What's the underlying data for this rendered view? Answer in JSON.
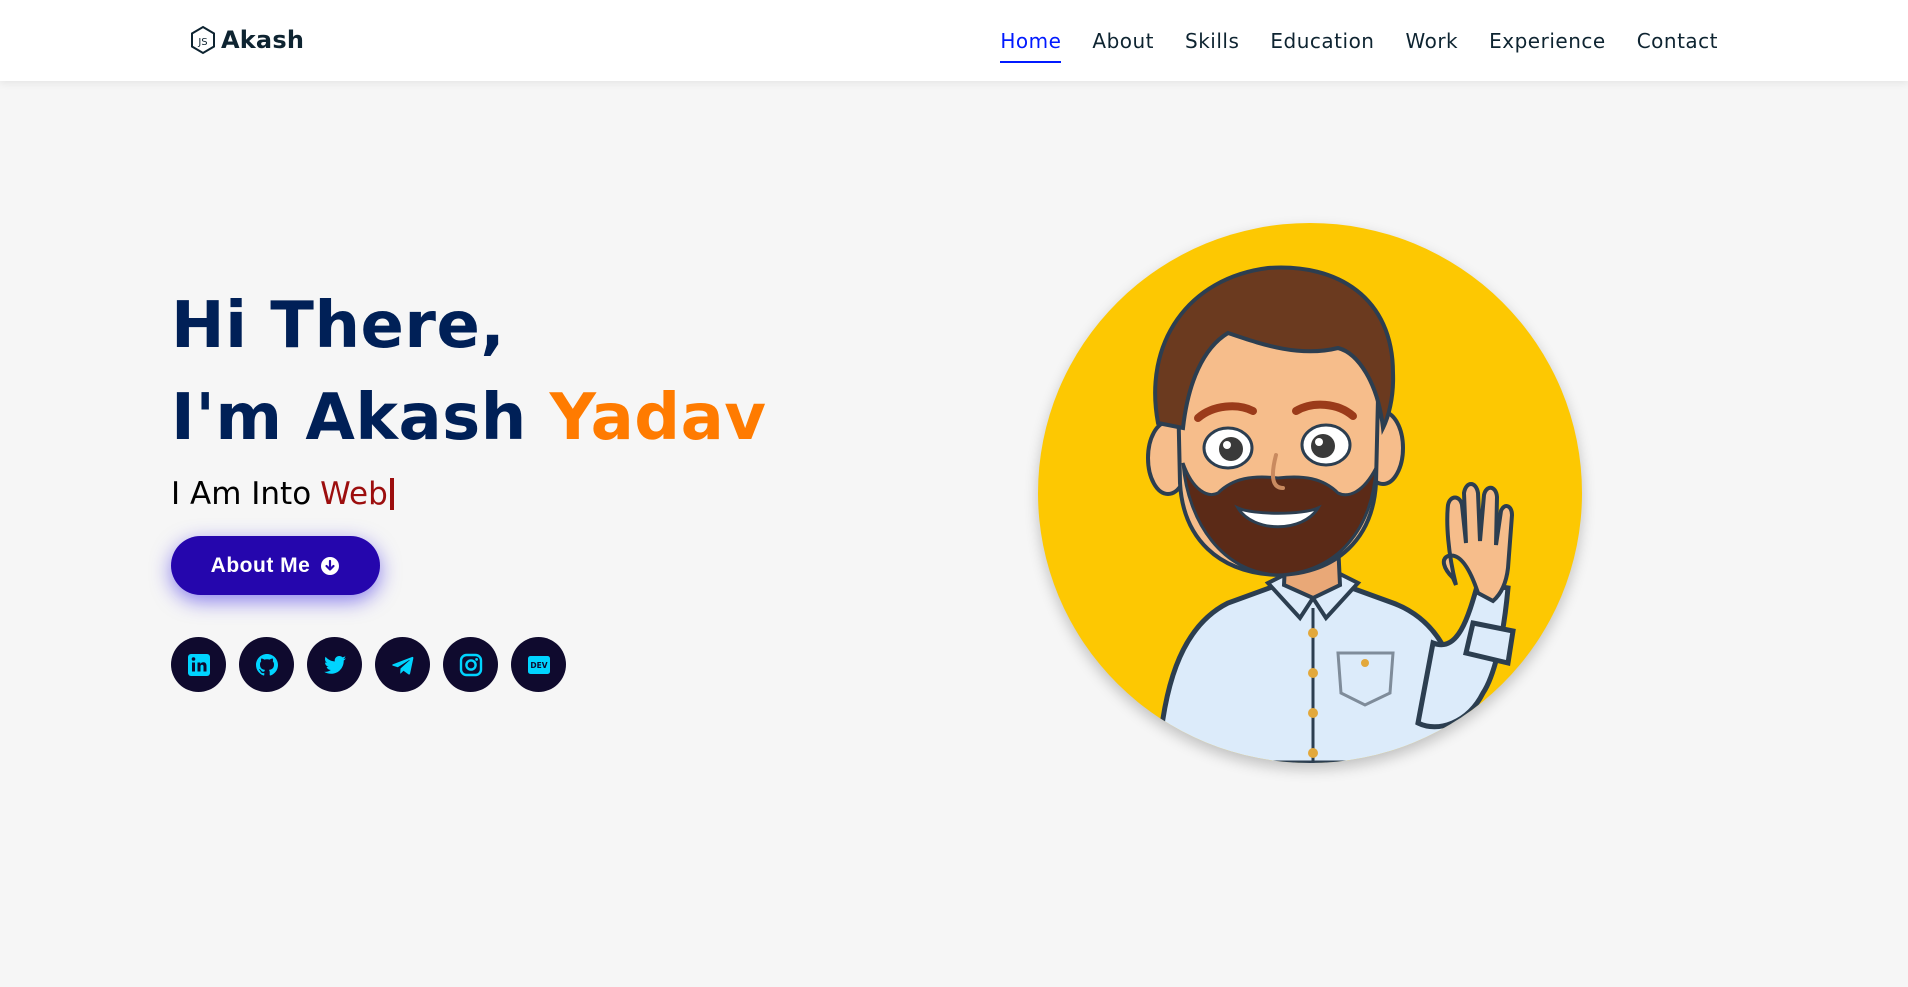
{
  "header": {
    "logo_text": "Akash",
    "logo_icon": "nodejs-hexagon-icon",
    "nav": [
      {
        "label": "Home",
        "active": true
      },
      {
        "label": "About",
        "active": false
      },
      {
        "label": "Skills",
        "active": false
      },
      {
        "label": "Education",
        "active": false
      },
      {
        "label": "Work",
        "active": false
      },
      {
        "label": "Experience",
        "active": false
      },
      {
        "label": "Contact",
        "active": false
      }
    ]
  },
  "hero": {
    "greeting": "Hi There,",
    "name_prefix": "I'm Akash",
    "name_highlight": "Yadav",
    "typed_prefix": "I Am Into",
    "typed_word": "Web",
    "button_label": "About Me",
    "button_icon": "arrow-circle-down-icon",
    "socials": [
      {
        "icon": "linkedin-icon"
      },
      {
        "icon": "github-icon"
      },
      {
        "icon": "twitter-icon"
      },
      {
        "icon": "telegram-icon"
      },
      {
        "icon": "instagram-icon"
      },
      {
        "icon": "dev-icon"
      }
    ],
    "avatar": "waving-cartoon-avatar"
  },
  "colors": {
    "heading": "#002057",
    "accent": "#ff7b00",
    "typed": "#9c0e0e",
    "button": "#2506ad",
    "nav_active": "#011aff",
    "social_bg": "#0f0a2e",
    "social_icon": "#00d4ff",
    "avatar_bg": "#fdc802"
  }
}
